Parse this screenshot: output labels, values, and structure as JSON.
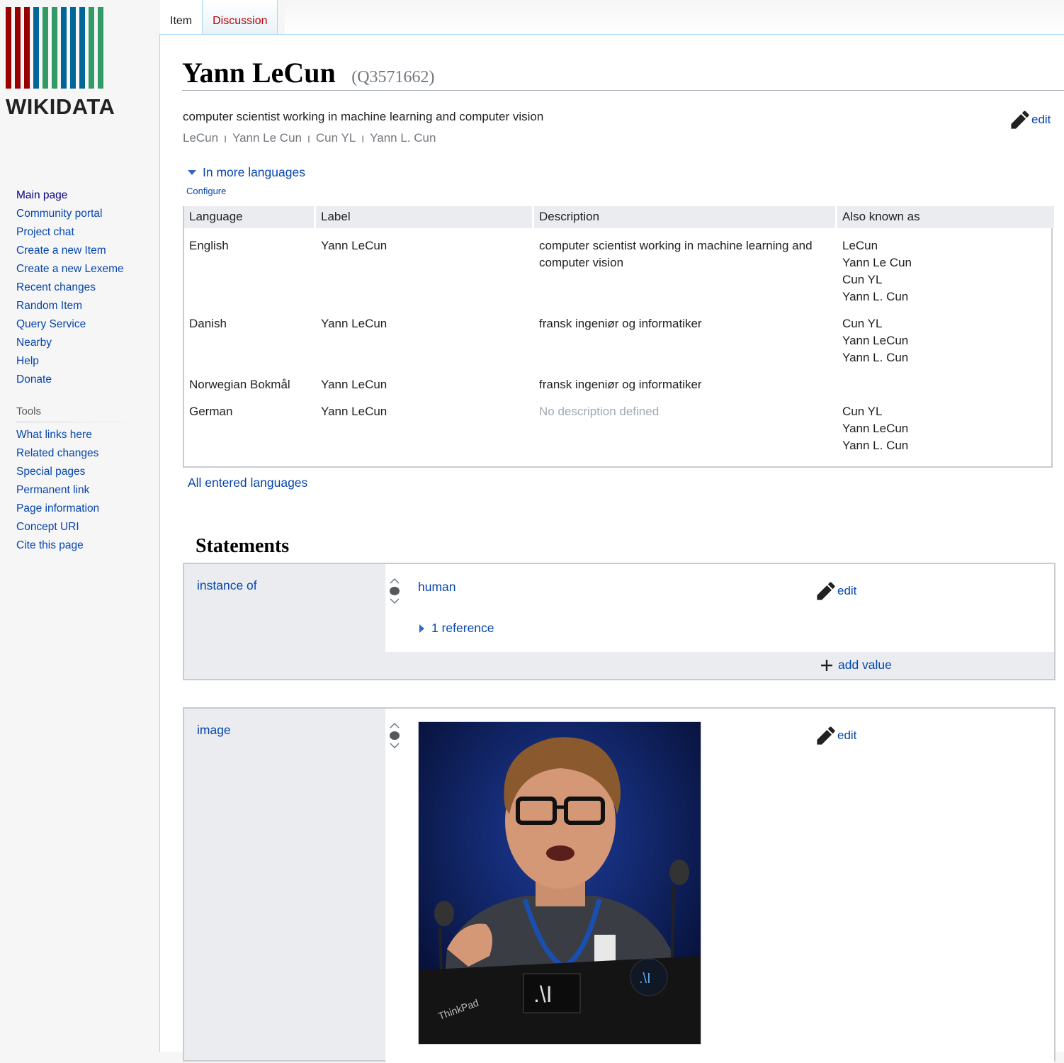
{
  "logo": {
    "wordmark": "WIKIDATA",
    "bar_colors": [
      "#990000",
      "#990000",
      "#990000",
      "#006699",
      "#339966",
      "#339966",
      "#006699",
      "#006699",
      "#006699",
      "#339966",
      "#339966"
    ]
  },
  "sidebar": {
    "main_nav": [
      "Main page",
      "Community portal",
      "Project chat",
      "Create a new Item",
      "Create a new Lexeme",
      "Recent changes",
      "Random Item",
      "Query Service",
      "Nearby",
      "Help",
      "Donate"
    ],
    "tools_heading": "Tools",
    "tools": [
      "What links here",
      "Related changes",
      "Special pages",
      "Permanent link",
      "Page information",
      "Concept URI",
      "Cite this page"
    ]
  },
  "tabs": {
    "item": "Item",
    "discussion": "Discussion"
  },
  "item": {
    "label": "Yann LeCun",
    "qid": "(Q3571662)",
    "description": "computer scientist working in machine learning and computer vision",
    "aliases": [
      "LeCun",
      "Yann Le Cun",
      "Cun YL",
      "Yann L. Cun"
    ],
    "alias_separator": "I",
    "edit": "edit"
  },
  "languages": {
    "toggle": "In more languages",
    "configure": "Configure",
    "headers": [
      "Language",
      "Label",
      "Description",
      "Also known as"
    ],
    "rows": [
      {
        "language": "English",
        "label": "Yann LeCun",
        "description": "computer scientist working in machine learning and computer vision",
        "aliases": [
          "LeCun",
          "Yann Le Cun",
          "Cun YL",
          "Yann L. Cun"
        ]
      },
      {
        "language": "Danish",
        "label": "Yann LeCun",
        "description": "fransk ingeniør og informatiker",
        "aliases": [
          "Cun YL",
          "Yann LeCun",
          "Yann L. Cun"
        ]
      },
      {
        "language": "Norwegian Bokmål",
        "label": "Yann LeCun",
        "description": "fransk ingeniør og informatiker",
        "aliases": []
      },
      {
        "language": "German",
        "label": "Yann LeCun",
        "description": "No description defined",
        "aliases": [
          "Cun YL",
          "Yann LeCun",
          "Yann L. Cun"
        ]
      }
    ],
    "all_link": "All entered languages"
  },
  "statements": {
    "heading": "Statements",
    "groups": [
      {
        "property": "instance of",
        "value": "human",
        "reference": "1 reference",
        "edit": "edit",
        "add_value": "add value"
      },
      {
        "property": "image",
        "value_icon": "portrait-photo-icon",
        "edit": "edit"
      }
    ]
  },
  "photo_text": {
    "laptop_brand": "ThinkPad",
    "laptop_sticker": ".\\I",
    "laptop_badge": ".\\I"
  }
}
